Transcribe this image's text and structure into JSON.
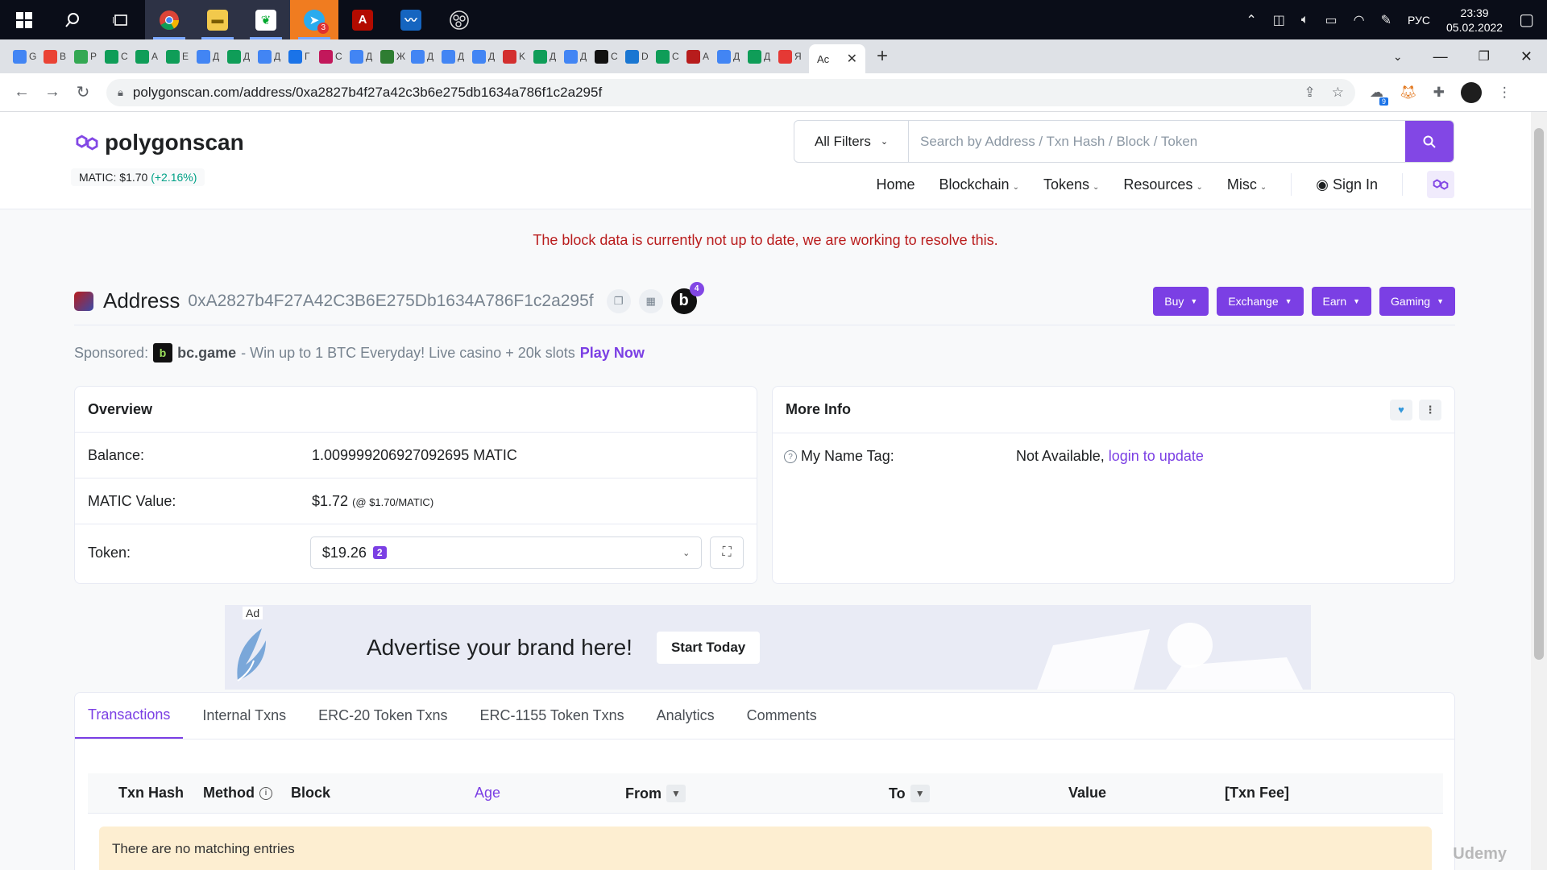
{
  "taskbar": {
    "apps": [
      {
        "name": "windows-start",
        "label": ""
      },
      {
        "name": "search",
        "label": ""
      },
      {
        "name": "task-view",
        "label": ""
      },
      {
        "name": "chrome",
        "label": ""
      },
      {
        "name": "file-explorer",
        "label": ""
      },
      {
        "name": "evernote",
        "label": ""
      },
      {
        "name": "telegram",
        "label": "",
        "badge": "3"
      },
      {
        "name": "pdf-reader",
        "label": ""
      },
      {
        "name": "monitor-app",
        "label": ""
      },
      {
        "name": "obs",
        "label": ""
      }
    ],
    "language": "РУС",
    "time": "23:39",
    "date": "05.02.2022"
  },
  "browser": {
    "tabs": [
      {
        "letter": "G"
      },
      {
        "letter": "B"
      },
      {
        "letter": "P"
      },
      {
        "letter": "C"
      },
      {
        "letter": "A"
      },
      {
        "letter": "E"
      },
      {
        "letter": "Д"
      },
      {
        "letter": "Д"
      },
      {
        "letter": "Д"
      },
      {
        "letter": "Г"
      },
      {
        "letter": "C"
      },
      {
        "letter": "Д"
      },
      {
        "letter": "Ж"
      },
      {
        "letter": "Д"
      },
      {
        "letter": "Д"
      },
      {
        "letter": "Д"
      },
      {
        "letter": "K"
      },
      {
        "letter": "Д"
      },
      {
        "letter": "Д"
      },
      {
        "letter": "C"
      },
      {
        "letter": "D"
      },
      {
        "letter": "C"
      },
      {
        "letter": "A"
      },
      {
        "letter": "Д"
      },
      {
        "letter": "Д"
      },
      {
        "letter": "Я"
      }
    ],
    "active_tab_label": "Ac",
    "url": "polygonscan.com/address/0xa2827b4f27a42c3b6e275db1634a786f1c2a295f",
    "ext_badge": "9"
  },
  "header": {
    "logo_text": "polygonscan",
    "price_label": "MATIC: $1.70",
    "price_change": "(+2.16%)",
    "filter_label": "All Filters",
    "search_placeholder": "Search by Address / Txn Hash / Block / Token",
    "nav": [
      {
        "label": "Home",
        "dropdown": false
      },
      {
        "label": "Blockchain",
        "dropdown": true
      },
      {
        "label": "Tokens",
        "dropdown": true
      },
      {
        "label": "Resources",
        "dropdown": true
      },
      {
        "label": "Misc",
        "dropdown": true
      }
    ],
    "sign_in": "Sign In"
  },
  "warning": "The block data is currently not up to date, we are working to resolve this.",
  "address": {
    "title": "Address",
    "hash": "0xA2827b4F27A42C3B6E275Db1634A786F1c2a295f",
    "b_badge": "4",
    "actions": [
      "Buy",
      "Exchange",
      "Earn",
      "Gaming"
    ]
  },
  "sponsored": {
    "label": "Sponsored:",
    "brand": "bc.game",
    "text": "- Win up to 1 BTC Everyday! Live casino + 20k slots",
    "cta": "Play Now"
  },
  "overview": {
    "title": "Overview",
    "balance_label": "Balance:",
    "balance_value": "1.009999206927092695 MATIC",
    "value_label": "MATIC Value:",
    "value_amount": "$1.72",
    "value_rate": "(@ $1.70/MATIC)",
    "token_label": "Token:",
    "token_value": "$19.26",
    "token_count": "2"
  },
  "more_info": {
    "title": "More Info",
    "name_tag_label": "My Name Tag:",
    "name_tag_value": "Not Available,",
    "name_tag_link": "login to update"
  },
  "ad": {
    "tag": "Ad",
    "text": "Advertise your brand here!",
    "cta": "Start Today"
  },
  "tabs": [
    {
      "label": "Transactions",
      "active": true
    },
    {
      "label": "Internal Txns",
      "active": false
    },
    {
      "label": "ERC-20 Token Txns",
      "active": false
    },
    {
      "label": "ERC-1155 Token Txns",
      "active": false
    },
    {
      "label": "Analytics",
      "active": false
    },
    {
      "label": "Comments",
      "active": false
    }
  ],
  "table": {
    "columns": {
      "txn_hash": "Txn Hash",
      "method": "Method",
      "block": "Block",
      "age": "Age",
      "from": "From",
      "to": "To",
      "value": "Value",
      "fee": "[Txn Fee]"
    },
    "empty_message": "There are no matching entries"
  },
  "watermark": "Udemy",
  "colors": {
    "accent": "#8247e5",
    "button": "#7b3fe4",
    "warning": "#b91c1c",
    "positive": "#00a186",
    "empty_bg": "#fdeed1"
  }
}
